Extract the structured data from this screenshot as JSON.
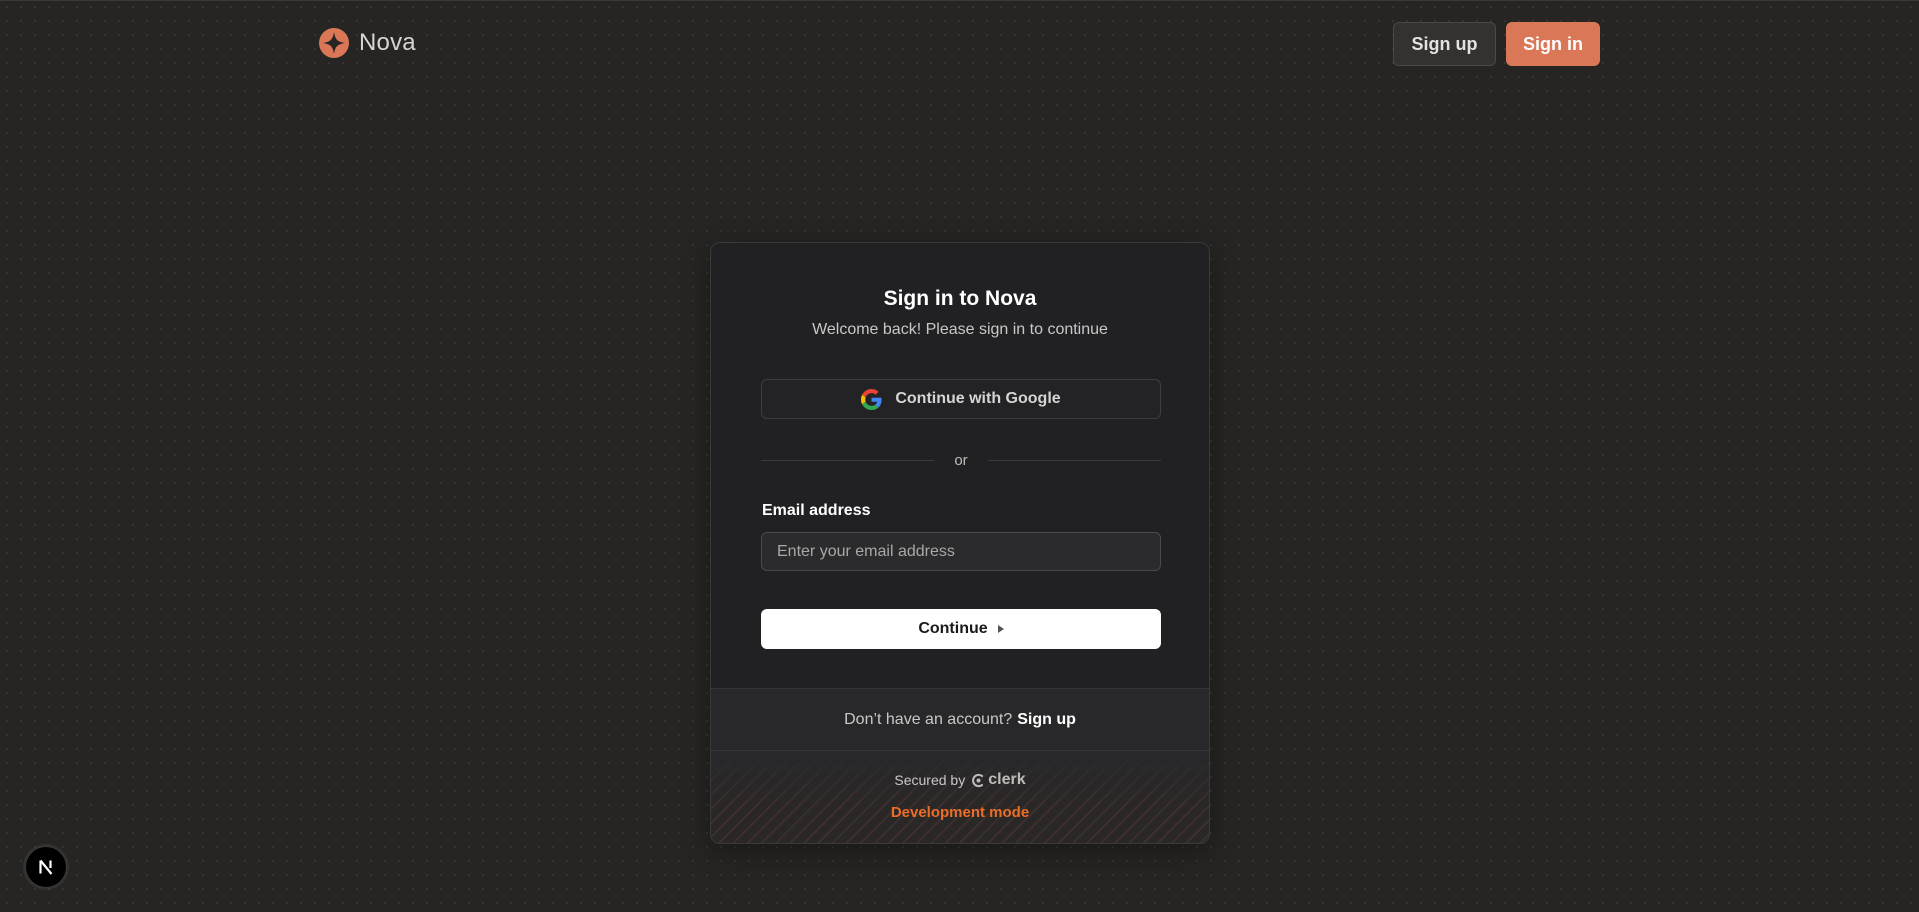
{
  "header": {
    "brand_name": "Nova",
    "logo_icon": "nova-star-logo",
    "signup_label": "Sign up",
    "signin_label": "Sign in"
  },
  "signin_card": {
    "title": "Sign in to Nova",
    "subtitle": "Welcome back! Please sign in to continue",
    "google_button_label": "Continue with Google",
    "divider_text": "or",
    "email_label": "Email address",
    "email_placeholder": "Enter your email address",
    "email_value": "",
    "continue_label": "Continue",
    "no_account_text": "Don’t have an account?",
    "signup_link": "Sign up",
    "secured_by_text": "Secured by",
    "clerk_brand": "clerk",
    "dev_mode_text": "Development mode"
  },
  "dev_badge": {
    "icon": "nextjs-icon"
  },
  "colors": {
    "background": "#262524",
    "accent": "#d97757",
    "card": "#212124",
    "dev_mode": "#ea6d28"
  }
}
